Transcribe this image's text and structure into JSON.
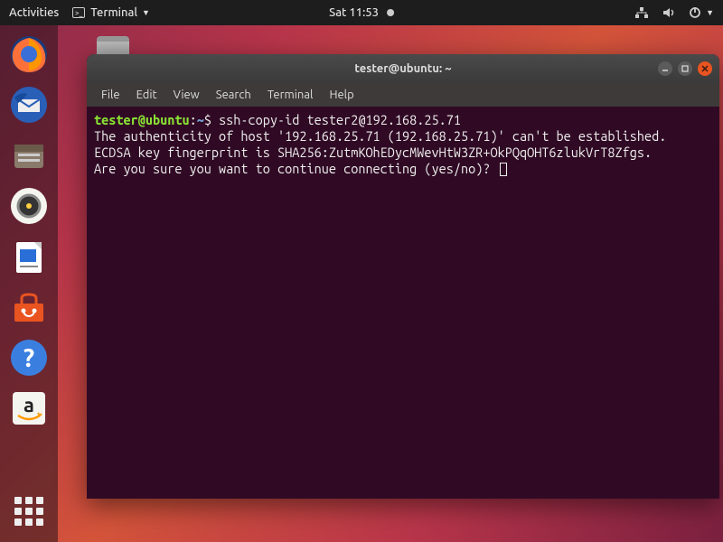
{
  "topbar": {
    "activities": "Activities",
    "app_label": "Terminal",
    "clock": "Sat 11:53"
  },
  "terminal": {
    "title": "tester@ubuntu: ~",
    "menus": {
      "file": "File",
      "edit": "Edit",
      "view": "View",
      "search": "Search",
      "terminal": "Terminal",
      "help": "Help"
    },
    "prompt": {
      "user_host": "tester@ubuntu",
      "colon": ":",
      "path": "~",
      "symbol": "$"
    },
    "command": "ssh-copy-id tester2@192.168.25.71",
    "output_lines": [
      "The authenticity of host '192.168.25.71 (192.168.25.71)' can't be established.",
      "ECDSA key fingerprint is SHA256:ZutmKOhEDycMWevHtW3ZR+OkPQqOHT6zlukVrT8Zfgs.",
      "Are you sure you want to continue connecting (yes/no)? "
    ]
  }
}
